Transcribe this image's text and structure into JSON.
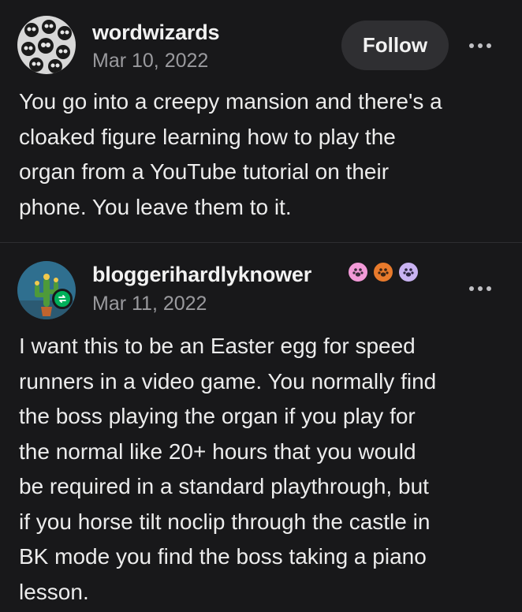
{
  "posts": [
    {
      "username": "wordwizards",
      "date": "Mar 10, 2022",
      "follow_label": "Follow",
      "more_icon": "more-dots-icon",
      "avatar_icon": "skulls-avatar",
      "body_lines": [
        "You go into a creepy mansion and there's a",
        "cloaked figure learning how to play the",
        "organ from a YouTube tutorial on their",
        "phone. You leave them to it."
      ]
    },
    {
      "username": "bloggerihardlyknower",
      "date": "Mar 11, 2022",
      "more_icon": "more-dots-icon",
      "avatar_icon": "cactus-avatar",
      "reblog_badge_icon": "reblog-icon",
      "badge_icons": [
        "paw-badge-pink",
        "paw-badge-orange",
        "paw-badge-lavender"
      ],
      "body_lines": [
        "I want this to be an Easter egg for speed",
        "runners in a video game. You normally find",
        "the boss playing the organ if you play for",
        "the normal like 20+ hours that you would",
        "be required in a standard playthrough, but",
        "if you horse tilt noclip through the castle in",
        "BK mode you find the boss taking a piano",
        "lesson."
      ]
    }
  ],
  "colors": {
    "background": "#18181a",
    "text": "#ececec",
    "muted": "#9a9a9e",
    "follow_button_bg": "#2f2f32",
    "reblog_green": "#00b05a"
  }
}
